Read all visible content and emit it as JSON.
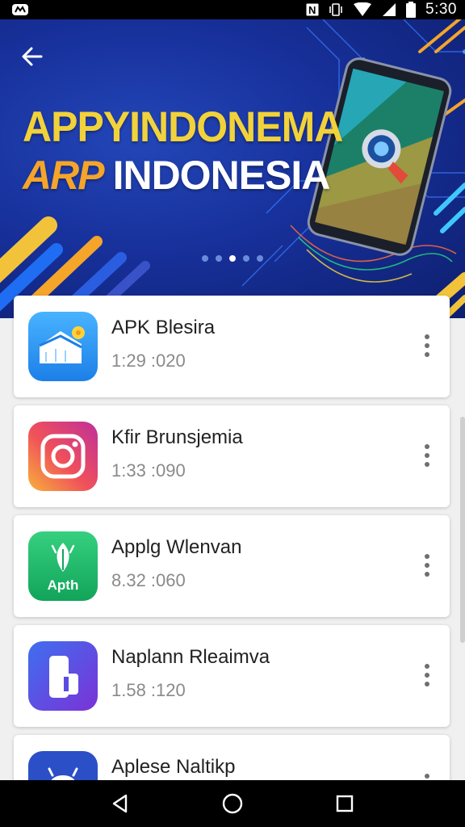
{
  "status_bar": {
    "time": "5:30",
    "icons": [
      "app-notification-icon",
      "nfc-icon",
      "vibrate-icon",
      "wifi-icon",
      "signal-icon",
      "battery-icon"
    ]
  },
  "hero": {
    "title_line1": "APPYINDONEMA",
    "logo_text": "ARP",
    "title_line2": "INDONESIA",
    "carousel_dots": 5,
    "active_dot": 2,
    "colors": {
      "background": "#17309a",
      "title_yellow": "#f2d23a",
      "logo_orange": "#f4a52a"
    }
  },
  "apps": [
    {
      "name": "APK Blesira",
      "meta": "1:29 :020",
      "icon": "folder-house-icon",
      "icon_color": "#2a8ef0"
    },
    {
      "name": "Kfir Brunsjemia",
      "meta": "1:33 :090",
      "icon": "instagram-camera-icon",
      "icon_color": "#e6415a"
    },
    {
      "name": "Applg Wlenvan",
      "meta": "8.32 :060",
      "icon": "android-leaf-icon",
      "icon_color": "#1fb86a",
      "icon_text": "Apth"
    },
    {
      "name": "Naplann Rleaimva",
      "meta": "1.58 :120",
      "icon": "phone-tab-icon",
      "icon_color": "#6b3fd8"
    },
    {
      "name": "Aplese Naltikp",
      "meta": "",
      "icon": "robot-icon",
      "icon_color": "#2b4fc6"
    }
  ],
  "nav": {
    "back": "back-triangle-icon",
    "home": "home-circle-icon",
    "recents": "recents-square-icon"
  }
}
